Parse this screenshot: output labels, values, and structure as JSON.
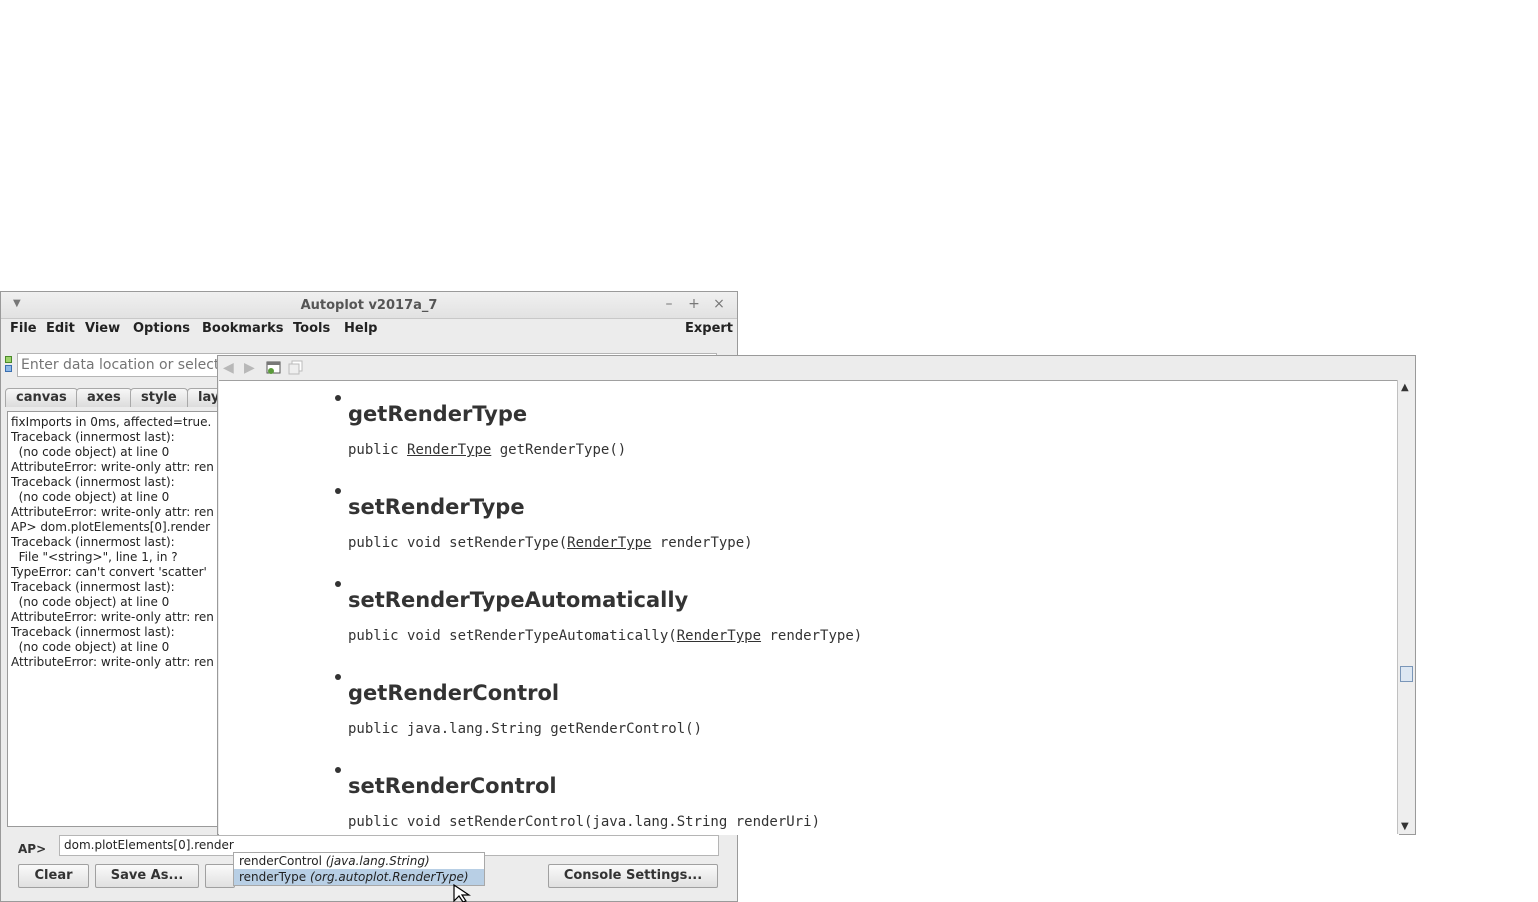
{
  "window": {
    "title": "Autoplot v2017a_7",
    "controls": [
      "–",
      "+",
      "×"
    ]
  },
  "menubar": {
    "items": [
      "File",
      "Edit",
      "View",
      "Options",
      "Bookmarks",
      "Tools",
      "Help"
    ],
    "expert": "Expert"
  },
  "address": {
    "placeholder": "Enter data location or select"
  },
  "tabs": [
    "canvas",
    "axes",
    "style",
    "lay"
  ],
  "console": {
    "lines": [
      "fixImports in 0ms, affected=true.",
      "Traceback (innermost last):",
      "  (no code object) at line 0",
      "AttributeError: write-only attr: ren",
      "Traceback (innermost last):",
      "  (no code object) at line 0",
      "AttributeError: write-only attr: ren",
      "",
      "AP> dom.plotElements[0].render",
      "Traceback (innermost last):",
      "  File \"<string>\", line 1, in ?",
      "TypeError: can't convert 'scatter'",
      "Traceback (innermost last):",
      "  (no code object) at line 0",
      "AttributeError: write-only attr: ren",
      "Traceback (innermost last):",
      "  (no code object) at line 0",
      "AttributeError: write-only attr: ren"
    ]
  },
  "prompt": {
    "label": "AP>",
    "value": "dom.plotElements[0].render"
  },
  "buttons": {
    "clear": "Clear",
    "save_as": "Save As...",
    "console_settings": "Console Settings..."
  },
  "completion": {
    "options": [
      {
        "name": "renderControl",
        "type": "(java.lang.String)",
        "selected": false
      },
      {
        "name": "renderType",
        "type": "(org.autoplot.RenderType)",
        "selected": true
      }
    ]
  },
  "doc": {
    "methods": [
      {
        "name": "getRenderType",
        "sig_pre": "public ",
        "sig_link": "RenderType",
        "sig_post": " getRenderType()"
      },
      {
        "name": "setRenderType",
        "sig_pre": "public void setRenderType(",
        "sig_link": "RenderType",
        "sig_post": " renderType)"
      },
      {
        "name": "setRenderTypeAutomatically",
        "sig_pre": "public void setRenderTypeAutomatically(",
        "sig_link": "RenderType",
        "sig_post": " renderType)"
      },
      {
        "name": "getRenderControl",
        "sig_pre": "public java.lang.String getRenderControl()",
        "sig_link": "",
        "sig_post": ""
      },
      {
        "name": "setRenderControl",
        "sig_pre": "public void setRenderControl(java.lang.String renderUri)",
        "sig_link": "",
        "sig_post": ""
      }
    ]
  },
  "icons": {
    "back": "left-arrow-icon",
    "forward": "right-arrow-icon",
    "open_browser": "browser-icon",
    "copy": "copy-icon"
  }
}
